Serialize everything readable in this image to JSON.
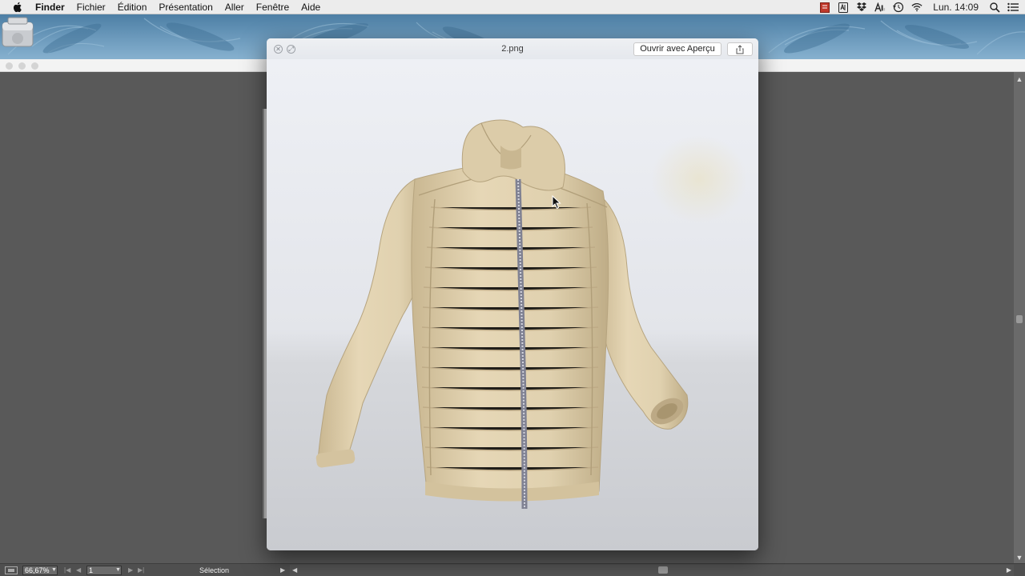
{
  "menubar": {
    "apple_icon": "apple-icon",
    "app_name": "Finder",
    "items": [
      "Fichier",
      "Édition",
      "Présentation",
      "Aller",
      "Fenêtre",
      "Aide"
    ],
    "status_icons": [
      "flashcard-icon",
      "notes-icon",
      "dropbox-icon",
      "adobe-icon",
      "timemachine-icon",
      "wifi-icon",
      "wifi-icon"
    ],
    "clock": "Lun. 14:09"
  },
  "quicklook": {
    "title": "2.png",
    "open_button": "Ouvrir avec Aperçu",
    "share_icon": "share-icon",
    "image_subject": "beige-puffer-jacket"
  },
  "bottombar": {
    "zoom": "66,67%",
    "page": "1",
    "selection_label": "Sélection"
  },
  "colors": {
    "jacket": "#e2d3b1",
    "jacket_shadow": "#c8b690",
    "zipper": "#8f90a0",
    "wallpaper": "#5f8fb4",
    "workspace": "#595959"
  }
}
